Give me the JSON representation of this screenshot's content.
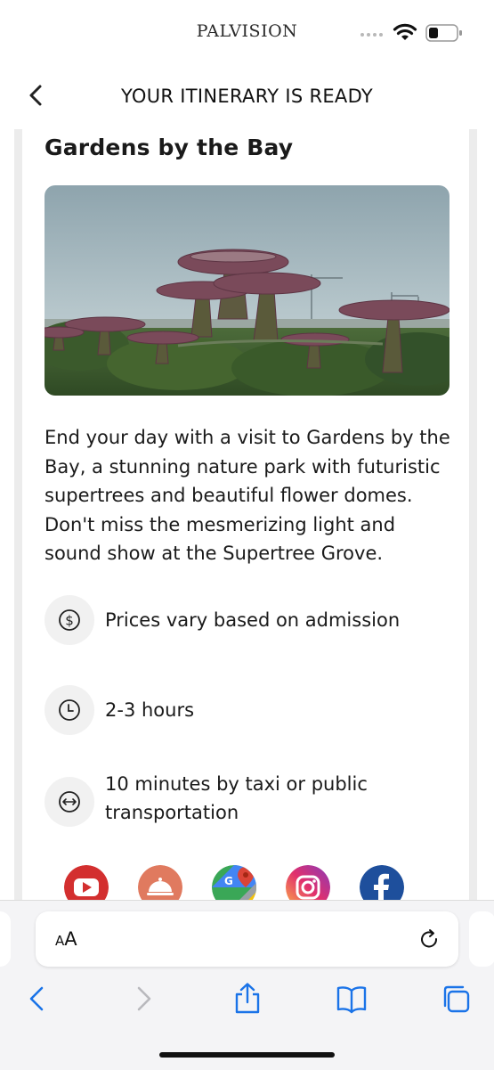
{
  "status_bar": {
    "brand": "PALVISION"
  },
  "header": {
    "title": "YOUR ITINERARY IS READY"
  },
  "place": {
    "title": "Gardens by the Bay",
    "description": "End your day with a visit to Gardens by the Bay, a stunning nature park with futuristic supertrees and beautiful flower domes. Don't miss the mesmerizing light and sound show at the Supertree Grove.",
    "price": "Prices vary based on admission",
    "duration": "2-3 hours",
    "transport": "10 minutes by taxi or public transportation"
  },
  "apps": [
    "youtube-icon",
    "restaurant-icon",
    "google-maps-icon",
    "instagram-icon",
    "facebook-icon"
  ],
  "browser": {
    "aa_small": "A",
    "aa_large": "A"
  },
  "colors": {
    "youtube": "#d32f2f",
    "restaurant": "#e07a5f",
    "facebook": "#1e4f9c",
    "safari_blue": "#1a73e8"
  }
}
